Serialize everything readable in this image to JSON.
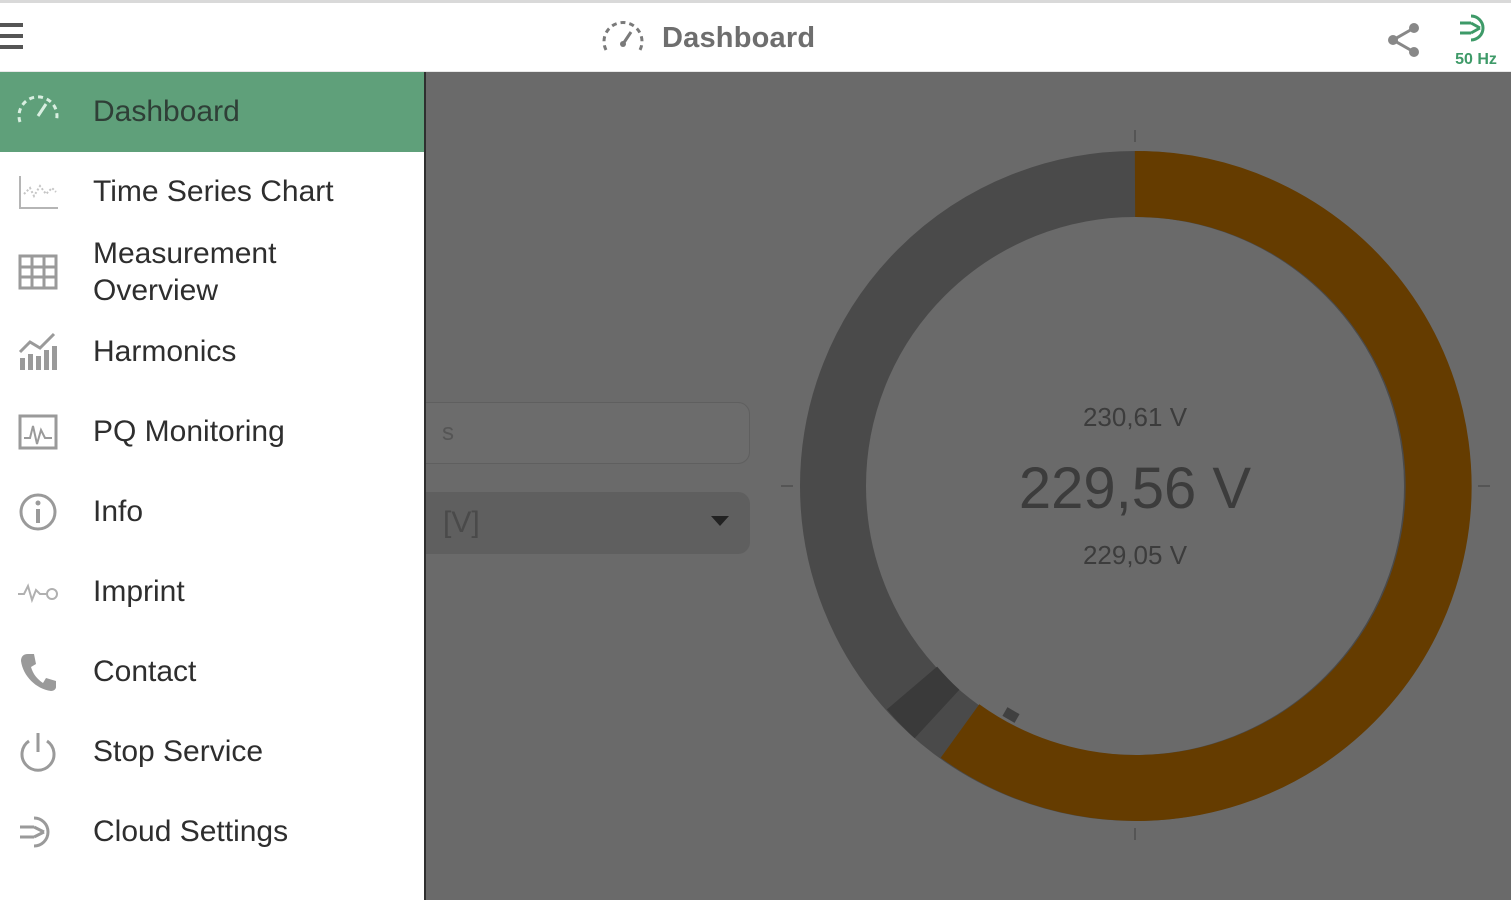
{
  "app_bar": {
    "title": "Dashboard",
    "frequency": "50 Hz"
  },
  "navigation": {
    "items": [
      {
        "label": "Dashboard",
        "icon": "speedometer-icon",
        "active": true
      },
      {
        "label": "Time Series Chart",
        "icon": "line-chart-icon",
        "active": false
      },
      {
        "label": "Measurement\nOverview",
        "icon": "table-grid-icon",
        "active": false
      },
      {
        "label": "Harmonics",
        "icon": "bar-chart-icon",
        "active": false
      },
      {
        "label": "PQ Monitoring",
        "icon": "monitor-waveform-icon",
        "active": false
      },
      {
        "label": "Info",
        "icon": "info-icon",
        "active": false
      },
      {
        "label": "Imprint",
        "icon": "imprint-icon",
        "active": false
      },
      {
        "label": "Contact",
        "icon": "phone-icon",
        "active": false
      },
      {
        "label": "Stop Service",
        "icon": "power-icon",
        "active": false
      },
      {
        "label": "Cloud Settings",
        "icon": "cloud-plug-icon",
        "active": false
      }
    ]
  },
  "dashboard": {
    "interval_field": "s",
    "unit_select": "[V]",
    "gauge": {
      "max_value": "230,61 V",
      "current_value": "229,56 V",
      "min_value": "229,05 V"
    }
  },
  "colors": {
    "accent_green": "#5fa07a",
    "gauge_value": "#653c00",
    "gauge_track": "#4a4a4a",
    "overlay": "#6a6a6a"
  }
}
